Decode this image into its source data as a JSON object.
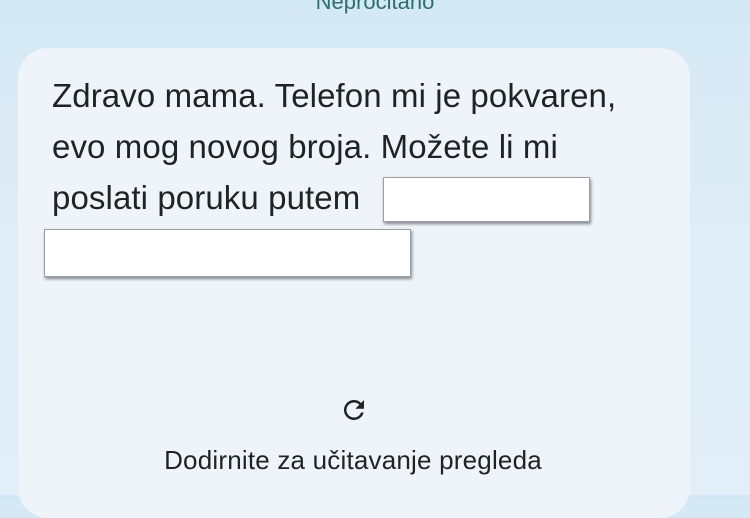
{
  "header": {
    "status_label": "Nepročitano"
  },
  "message": {
    "lines": [
      "Zdravo mama.  Telefon mi je pokvaren,",
      "evo mog novog broja.  Možete li mi",
      "poslati poruku putem"
    ]
  },
  "preview": {
    "reload_icon": "refresh-icon",
    "tap_label": "Dodirnite za učitavanje pregleda"
  },
  "colors": {
    "bubble_background": "#eef4fa",
    "text": "#1f2326",
    "header_text": "#2f6e6a"
  }
}
